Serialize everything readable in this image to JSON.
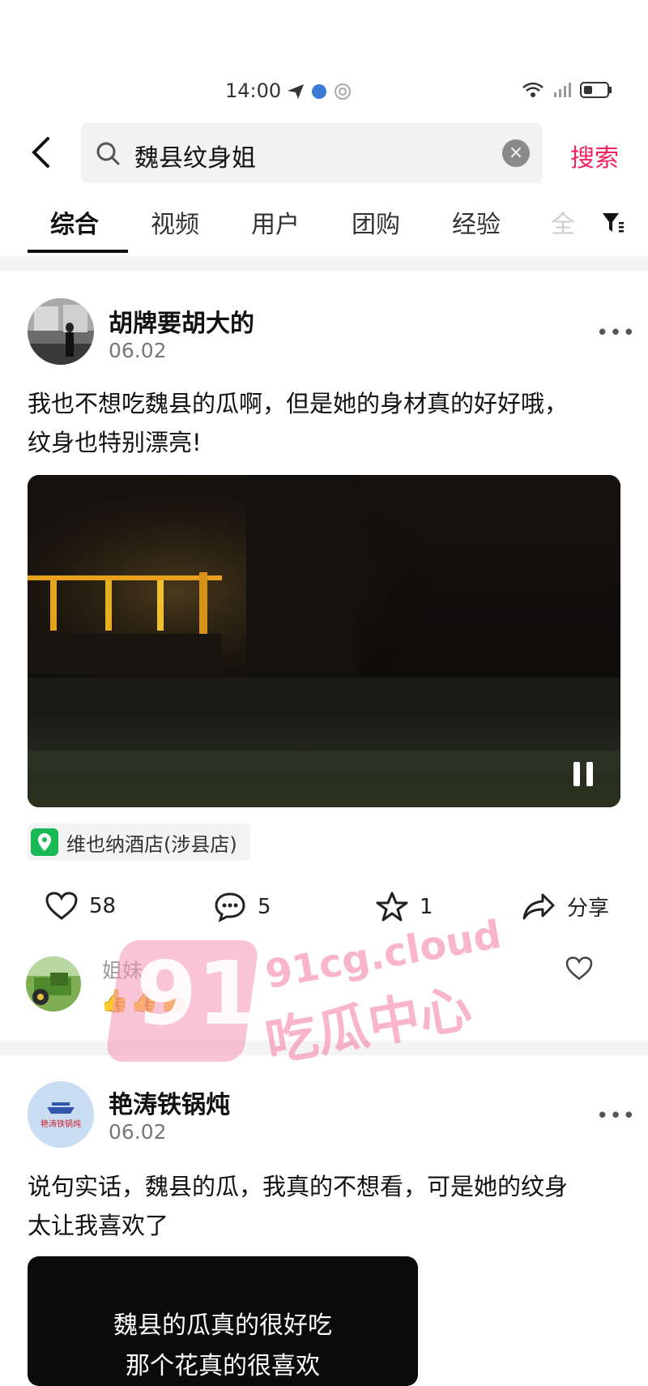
{
  "status_bar": {
    "time": "14:00"
  },
  "search": {
    "query": "魏县纹身姐",
    "clear": "×",
    "submit_label": "搜索"
  },
  "tabs": [
    {
      "label": "综合"
    },
    {
      "label": "视频"
    },
    {
      "label": "用户"
    },
    {
      "label": "团购"
    },
    {
      "label": "经验"
    },
    {
      "label": "全"
    }
  ],
  "posts": [
    {
      "author": "胡牌要胡大的",
      "date": "06.02",
      "text_line1": "我也不想吃魏县的瓜啊，但是她的身材真的好好哦，",
      "text_line2": "纹身也特别漂亮!",
      "location": "维也纳酒店(涉县店)",
      "actions": {
        "likes": "58",
        "comments": "5",
        "favorites": "1",
        "share_label": "分享"
      },
      "top_comment": {
        "user": "姐妹",
        "text": "👍👍👍"
      }
    },
    {
      "author": "艳涛铁锅炖",
      "avatar_text": "艳涛铁锅炖",
      "date": "06.02",
      "text_line1": "说句实话，魏县的瓜，我真的不想看，可是她的纹身",
      "text_line2": "太让我喜欢了",
      "card_line1": "魏县的瓜真的很好吃",
      "card_line2": "那个花真的很喜欢"
    }
  ],
  "watermark": {
    "number": "91",
    "site": "91cg.cloud",
    "name": "吃瓜中心"
  },
  "colors": {
    "accent": "#f0245a",
    "location_pin": "#19b955"
  }
}
